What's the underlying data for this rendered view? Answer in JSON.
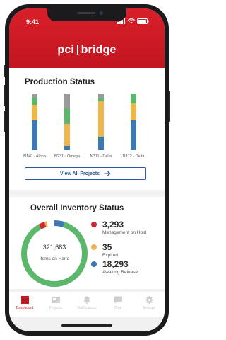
{
  "status_bar": {
    "time": "9:41"
  },
  "header": {
    "brand_left": "pci",
    "brand_right": "bridge"
  },
  "production": {
    "title": "Production Status",
    "view_all_label": "View All Projects",
    "projects": [
      {
        "name": "N140 - Alpha",
        "segments": [
          {
            "color": "#3c78b5",
            "fraction": 0.52
          },
          {
            "color": "#f0b54b",
            "fraction": 0.28
          },
          {
            "color": "#5bb86a",
            "fraction": 0.12
          },
          {
            "color": "#9a9a9a",
            "fraction": 0.08
          }
        ]
      },
      {
        "name": "N231 - Omega",
        "segments": [
          {
            "color": "#3c78b5",
            "fraction": 0.08
          },
          {
            "color": "#f0b54b",
            "fraction": 0.38
          },
          {
            "color": "#5bb86a",
            "fraction": 0.28
          },
          {
            "color": "#9a9a9a",
            "fraction": 0.26
          }
        ]
      },
      {
        "name": "N311 - Delta",
        "segments": [
          {
            "color": "#3c78b5",
            "fraction": 0.24
          },
          {
            "color": "#f0b54b",
            "fraction": 0.62
          },
          {
            "color": "#5bb86a",
            "fraction": 0.06
          },
          {
            "color": "#9a9a9a",
            "fraction": 0.08
          }
        ]
      },
      {
        "name": "N312 - Delta",
        "segments": [
          {
            "color": "#3c78b5",
            "fraction": 0.52
          },
          {
            "color": "#f0b54b",
            "fraction": 0.3
          },
          {
            "color": "#5bb86a",
            "fraction": 0.18
          }
        ]
      }
    ]
  },
  "inventory": {
    "title": "Overall Inventory Status",
    "total": "321,683",
    "total_label": "Items on Hand",
    "ring_colors": {
      "on_hand": "#5bb86a",
      "management_hold": "#d0262f",
      "expired": "#f0b54b",
      "awaiting_release": "#3c78b5"
    },
    "ring_fractions": {
      "on_hand": 0.87,
      "management_hold": 0.03,
      "expired": 0.01,
      "awaiting_release": 0.09
    },
    "legend": [
      {
        "value": "3,293",
        "label": "Management on Hold",
        "color": "#d0262f"
      },
      {
        "value": "35",
        "label": "Expired",
        "color": "#f0b54b"
      },
      {
        "value": "18,293",
        "label": "Awaiting Release",
        "color": "#3c78b5"
      }
    ]
  },
  "tabs": [
    {
      "label": "Dashboard",
      "icon": "dashboard-icon",
      "active": true
    },
    {
      "label": "Projects",
      "icon": "projects-icon",
      "active": false
    },
    {
      "label": "Notifications",
      "icon": "bell-icon",
      "active": false
    },
    {
      "label": "Chat",
      "icon": "chat-icon",
      "active": false
    },
    {
      "label": "Settings",
      "icon": "gear-icon",
      "active": false
    }
  ]
}
